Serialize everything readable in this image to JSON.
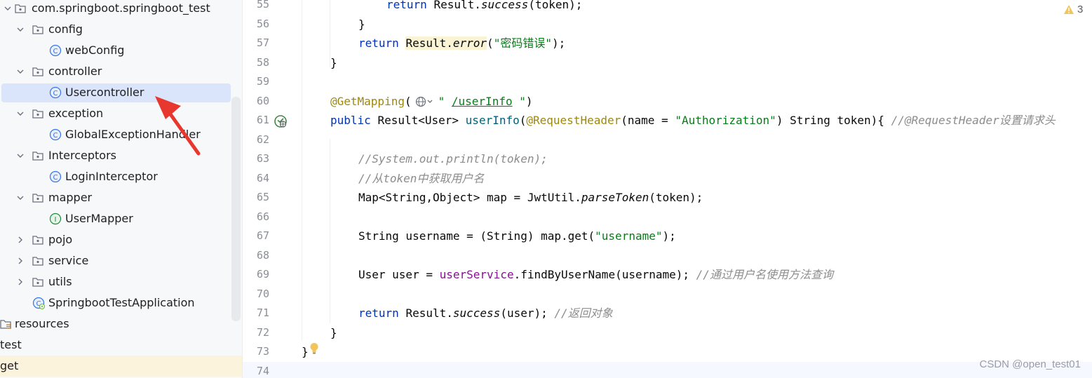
{
  "project_tree": {
    "items": [
      {
        "label": "com.springboot.springboot_test",
        "type": "package",
        "expanded": true
      },
      {
        "label": "config",
        "type": "package",
        "expanded": true
      },
      {
        "label": "webConfig",
        "type": "class"
      },
      {
        "label": "controller",
        "type": "package",
        "expanded": true
      },
      {
        "label": "Usercontroller",
        "type": "class",
        "selected": true
      },
      {
        "label": "exception",
        "type": "package",
        "expanded": true
      },
      {
        "label": "GlobalExceptionHandler",
        "type": "class"
      },
      {
        "label": "Interceptors",
        "type": "package",
        "expanded": true
      },
      {
        "label": "LoginInterceptor",
        "type": "class"
      },
      {
        "label": "mapper",
        "type": "package",
        "expanded": true
      },
      {
        "label": "UserMapper",
        "type": "interface"
      },
      {
        "label": "pojo",
        "type": "package",
        "expanded": false
      },
      {
        "label": "service",
        "type": "package",
        "expanded": false
      },
      {
        "label": "utils",
        "type": "package",
        "expanded": false
      },
      {
        "label": "SpringbootTestApplication",
        "type": "spring-boot-app"
      },
      {
        "label": "resources",
        "type": "resources-folder"
      },
      {
        "label": "test",
        "type": "folder"
      },
      {
        "label": "get",
        "type": "folder",
        "highlighted": true
      }
    ]
  },
  "editor": {
    "warning_count": "3",
    "lines": [
      {
        "n": "55",
        "tokens": [
          [
            "k",
            "return"
          ],
          [
            "",
            "Result."
          ],
          [
            "i",
            "success"
          ],
          [
            "",
            "(token);"
          ]
        ]
      },
      {
        "n": "56",
        "tokens": [
          [
            "",
            "}"
          ]
        ]
      },
      {
        "n": "57",
        "tokens": [
          [
            "k",
            "return"
          ],
          [
            "hl",
            "Result."
          ],
          [
            "hl i",
            "error"
          ],
          [
            "",
            "("
          ],
          [
            "s",
            "\"密码错误\""
          ],
          [
            "",
            ");"
          ]
        ]
      },
      {
        "n": "58",
        "tokens": [
          [
            "",
            "}"
          ]
        ]
      },
      {
        "n": "59",
        "tokens": []
      },
      {
        "n": "60",
        "tokens": [
          [
            "a",
            "@GetMapping"
          ],
          [
            "",
            "("
          ]
        ],
        "after_globe": [
          [
            "s",
            "\""
          ],
          [
            "s u",
            "/userInfo"
          ],
          [
            "s",
            "\""
          ],
          [
            "",
            ")"
          ]
        ]
      },
      {
        "n": "61",
        "tokens": [
          [
            "k",
            "public"
          ],
          [
            "",
            "Result<User>"
          ],
          [
            "f",
            "userInfo"
          ],
          [
            "",
            "("
          ],
          [
            "a",
            "@RequestHeader"
          ],
          [
            "",
            "(name ="
          ],
          [
            "s",
            "\"Authorization\""
          ],
          [
            "",
            ") String token){"
          ],
          [
            "c",
            "//@RequestHeader设置请求头"
          ]
        ]
      },
      {
        "n": "62",
        "tokens": []
      },
      {
        "n": "63",
        "tokens": [
          [
            "c",
            "//System.out.println(token);"
          ]
        ]
      },
      {
        "n": "64",
        "tokens": [
          [
            "c",
            "//从token中获取用户名"
          ]
        ]
      },
      {
        "n": "65",
        "tokens": [
          [
            "",
            "Map<String,Object> map = JwtUtil."
          ],
          [
            "i",
            "parseToken"
          ],
          [
            "",
            "(token);"
          ]
        ]
      },
      {
        "n": "66",
        "tokens": []
      },
      {
        "n": "67",
        "tokens": [
          [
            "",
            "String username = (String) map.get("
          ],
          [
            "s",
            "\"username\""
          ],
          [
            "",
            ");"
          ]
        ]
      },
      {
        "n": "68",
        "tokens": []
      },
      {
        "n": "69",
        "tokens": [
          [
            "",
            "User user ="
          ],
          [
            "fd",
            "userService"
          ],
          [
            "",
            ".findByUserName(username);"
          ],
          [
            "c",
            "//通过用户名使用方法查询"
          ]
        ]
      },
      {
        "n": "70",
        "tokens": []
      },
      {
        "n": "71",
        "tokens": [
          [
            "k",
            "return"
          ],
          [
            "",
            "Result."
          ],
          [
            "i",
            "success"
          ],
          [
            "",
            "(user);"
          ],
          [
            "c",
            "//返回对象"
          ]
        ]
      },
      {
        "n": "72",
        "tokens": [
          [
            "",
            "}"
          ]
        ]
      },
      {
        "n": "73",
        "tokens": [
          [
            "",
            "}"
          ]
        ]
      },
      {
        "n": "74",
        "tokens": [],
        "current": true
      }
    ]
  },
  "watermark": "CSDN @open_test01",
  "colors": {
    "keyword": "#0033b3",
    "annotation": "#9e880d",
    "string": "#067d17",
    "method_decl": "#00627a",
    "field": "#871094",
    "comment": "#8c8c8c",
    "selection": "#dae4fa",
    "arrow": "#e8372f"
  }
}
